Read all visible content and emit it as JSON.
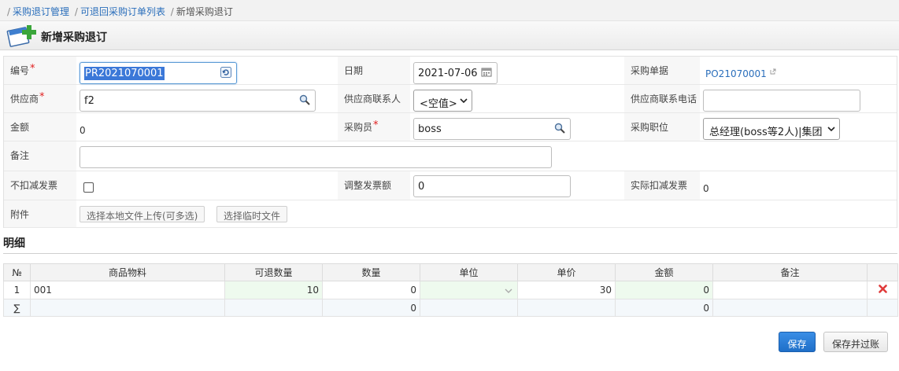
{
  "breadcrumb": {
    "items": [
      "采购退订管理",
      "可退回采购订单列表"
    ],
    "current": "新增采购退订"
  },
  "page": {
    "title": "新增采购退订"
  },
  "form": {
    "bianhao": {
      "label": "编号",
      "value": "PR2021070001"
    },
    "riqi": {
      "label": "日期",
      "value": "2021-07-06"
    },
    "caigoudanju": {
      "label": "采购单据",
      "value": "PO21070001"
    },
    "gongyingshang": {
      "label": "供应商",
      "value": "f2"
    },
    "gongyingshanglianxiren": {
      "label": "供应商联系人",
      "value": "<空值>"
    },
    "gongyingshanglianxidianhua": {
      "label": "供应商联系电话",
      "value": ""
    },
    "jine": {
      "label": "金额",
      "value": "0"
    },
    "caigouyuan": {
      "label": "采购员",
      "value": "boss"
    },
    "caigouzhiwei": {
      "label": "采购职位",
      "value": "总经理(boss等2人)|集团"
    },
    "beizhu": {
      "label": "备注",
      "value": ""
    },
    "bukoujianfapiao": {
      "label": "不扣减发票"
    },
    "tiaozhengfapiaoe": {
      "label": "调整发票额",
      "value": "0"
    },
    "shijikoujianfapiao": {
      "label": "实际扣减发票",
      "value": "0"
    },
    "fujian": {
      "label": "附件",
      "upload_local": "选择本地文件上传(可多选)",
      "upload_temp": "选择临时文件"
    }
  },
  "detail": {
    "title": "明细",
    "headers": [
      "№",
      "商品物料",
      "可退数量",
      "数量",
      "单位",
      "单价",
      "金额",
      "备注"
    ],
    "rows": [
      {
        "no": "1",
        "item": "001",
        "returnable_qty": "10",
        "qty": "0",
        "unit": "",
        "price": "30",
        "amount": "0",
        "note": ""
      }
    ],
    "sum": {
      "symbol": "∑",
      "qty": "0",
      "amount": "0"
    }
  },
  "actions": {
    "save": "保存",
    "save_and_post": "保存并过账"
  },
  "colors": {
    "accent": "#2a6ebb",
    "required": "#e02020",
    "primary_button": "#2578d4"
  }
}
